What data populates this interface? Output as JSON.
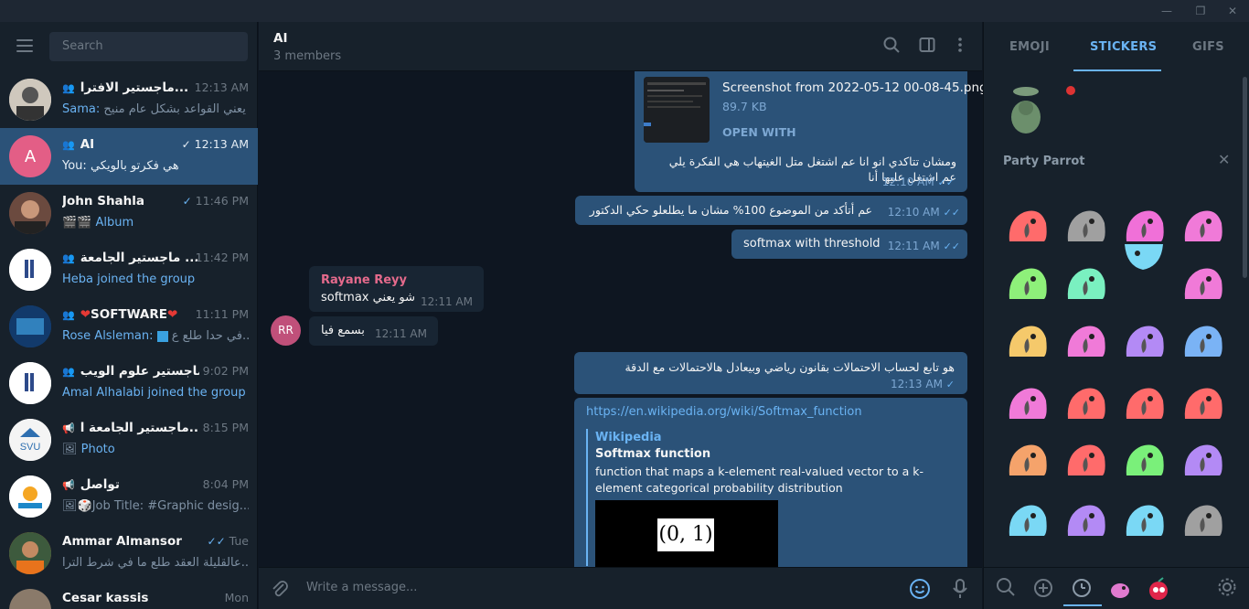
{
  "search": {
    "placeholder": "Search"
  },
  "chats": [
    {
      "name": "ماجستير الافترا...",
      "time": "12:13 AM",
      "sender": "Sama:",
      "preview": "يعني القواعد بشكل عام منيح"
    },
    {
      "name": "AI",
      "time": "12:13 AM",
      "sender": "You:",
      "preview": "هي فكرتو بالويكي",
      "avatar_letter": "A"
    },
    {
      "name": "John Shahla",
      "time": "11:46 PM",
      "preview": "Album"
    },
    {
      "name": "ماجستير الجامعة ...",
      "time": "11:42 PM",
      "preview": "Heba joined the group"
    },
    {
      "name": "SOFTWARE",
      "time": "11:11 PM",
      "sender": "Rose Alsleman:",
      "preview": "في حدا طلع ع..."
    },
    {
      "name": "ماجستير علوم الويب",
      "time": "9:02 PM",
      "preview": "Amal Alhalabi joined the group"
    },
    {
      "name": "ماجستير الجامعة ا...",
      "time": "8:15 PM",
      "preview": "Photo"
    },
    {
      "name": "تواصل",
      "time": "8:04 PM",
      "preview": "Job Title: #Graphic desig..."
    },
    {
      "name": "Ammar Almansor",
      "time": "Tue",
      "preview": "عالقليلة العقد طلع ما في شرط الترا..."
    },
    {
      "name": "Cesar kassis",
      "time": "Mon",
      "preview": ""
    }
  ],
  "header": {
    "title": "AI",
    "subtitle": "3 members"
  },
  "messages": {
    "file_name": "Screenshot from 2022-05-12 00-08-45.png",
    "file_size": "89.7 KB",
    "open_with": "OPEN WITH",
    "m1_text": "ومشان تتاكدي انو انا عم اشتغل متل الغيتهاب هي الفكرة يلي عم اشتغل عليها أنا",
    "m1_time": "12:10 AM",
    "m2_text": "عم أتأكد من الموضوع 100% مشان ما يطلعلو حكي الدكتور",
    "m2_time": "12:10 AM",
    "m3_text": "softmax with threshold",
    "m3_time": "12:11 AM",
    "in1_sender": "Rayane Reyy",
    "in1_text": "softmax شو يعني",
    "in1_time": "12:11 AM",
    "in2_text": "بسمع فيا",
    "in2_time": "12:11 AM",
    "in_avatar": "RR",
    "m4_text": "هو تابع لحساب الاحتمالات بقانون رياضي وبيعادل هالاحتمالات مع الدقة",
    "m4_time": "12:13 AM",
    "link_url": "https://en.wikipedia.org/wiki/Softmax_function",
    "link_site": "Wikipedia",
    "link_title": "Softmax function",
    "link_desc": "function that maps a k-element real-valued vector to a k-element categorical probability distribution",
    "link_image_text": "(0, 1)"
  },
  "composer": {
    "placeholder": "Write a message..."
  },
  "tabs": {
    "emoji": "EMOJI",
    "stickers": "STICKERS",
    "gifs": "GIFS"
  },
  "sticker_pack": {
    "name": "Party Parrot"
  }
}
